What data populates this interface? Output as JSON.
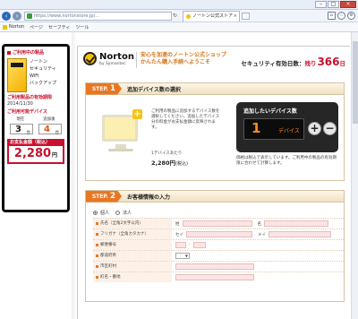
{
  "browser": {
    "url": "https://www.nortonstore.jp/...",
    "tab_title": "ノートン公式ストア",
    "favorites": [
      {
        "label": "Norton"
      },
      {
        "label": "ページ"
      },
      {
        "label": "セーフティ"
      },
      {
        "label": "ツール"
      }
    ]
  },
  "cart": {
    "heading": "ご利用中の製品",
    "product_name_lines": [
      "ノートン",
      "セキュリティ",
      "WiFi",
      "バックアップ"
    ],
    "expiry_label": "ご利用製品の有効期限",
    "expiry_date": "2014/11/30",
    "devices_label": "ご利用可能デバイス",
    "current_label": "現在",
    "added_label": "追加後",
    "current_count": "3",
    "added_count": "4",
    "count_unit": "台",
    "price_label": "お支払金額（税込）",
    "price_value": "2,280",
    "price_unit": "円"
  },
  "header": {
    "brand": "Norton",
    "brand_sub": "by Symantec",
    "tagline_line1": "安心を加速のノートン公式ショップ",
    "tagline_line2": "かんたん購入手続へようこそ",
    "validity_label": "セキュリティ有効日数：",
    "validity_prefix": "残り",
    "validity_days": "366",
    "validity_unit": "日"
  },
  "step1": {
    "badge": "STEP.",
    "number": "1",
    "title": "追加デバイス数の選択",
    "description": "ご利用の製品に追加するデバイス数を選択してください。追加したデバイス分の料金がお支払金額に反映されます。",
    "unit_note": "1デバイスあたり",
    "unit_price": "2,280円",
    "unit_tax": "(税込)",
    "panel_label": "追加したいデバイス数",
    "device_count": "1",
    "device_unit": "デバイス",
    "note": "価格は税込で表示しています。ご利用中の製品の有効期限に合わせて計算します。"
  },
  "step2": {
    "badge": "STEP.",
    "number": "2",
    "title": "お客様情報の入力",
    "radio_options": [
      "個人",
      "法人"
    ],
    "fields": [
      {
        "label": "氏名（全角2文字以内）",
        "parts": [
          "姓",
          "名"
        ]
      },
      {
        "label": "フリガナ（全角カタカナ）",
        "parts": [
          "セイ",
          "メイ"
        ]
      },
      {
        "label": "郵便番号",
        "parts": []
      },
      {
        "label": "都道府県",
        "parts": []
      },
      {
        "label": "市区町村",
        "parts": []
      },
      {
        "label": "町名・番地",
        "parts": []
      }
    ]
  }
}
